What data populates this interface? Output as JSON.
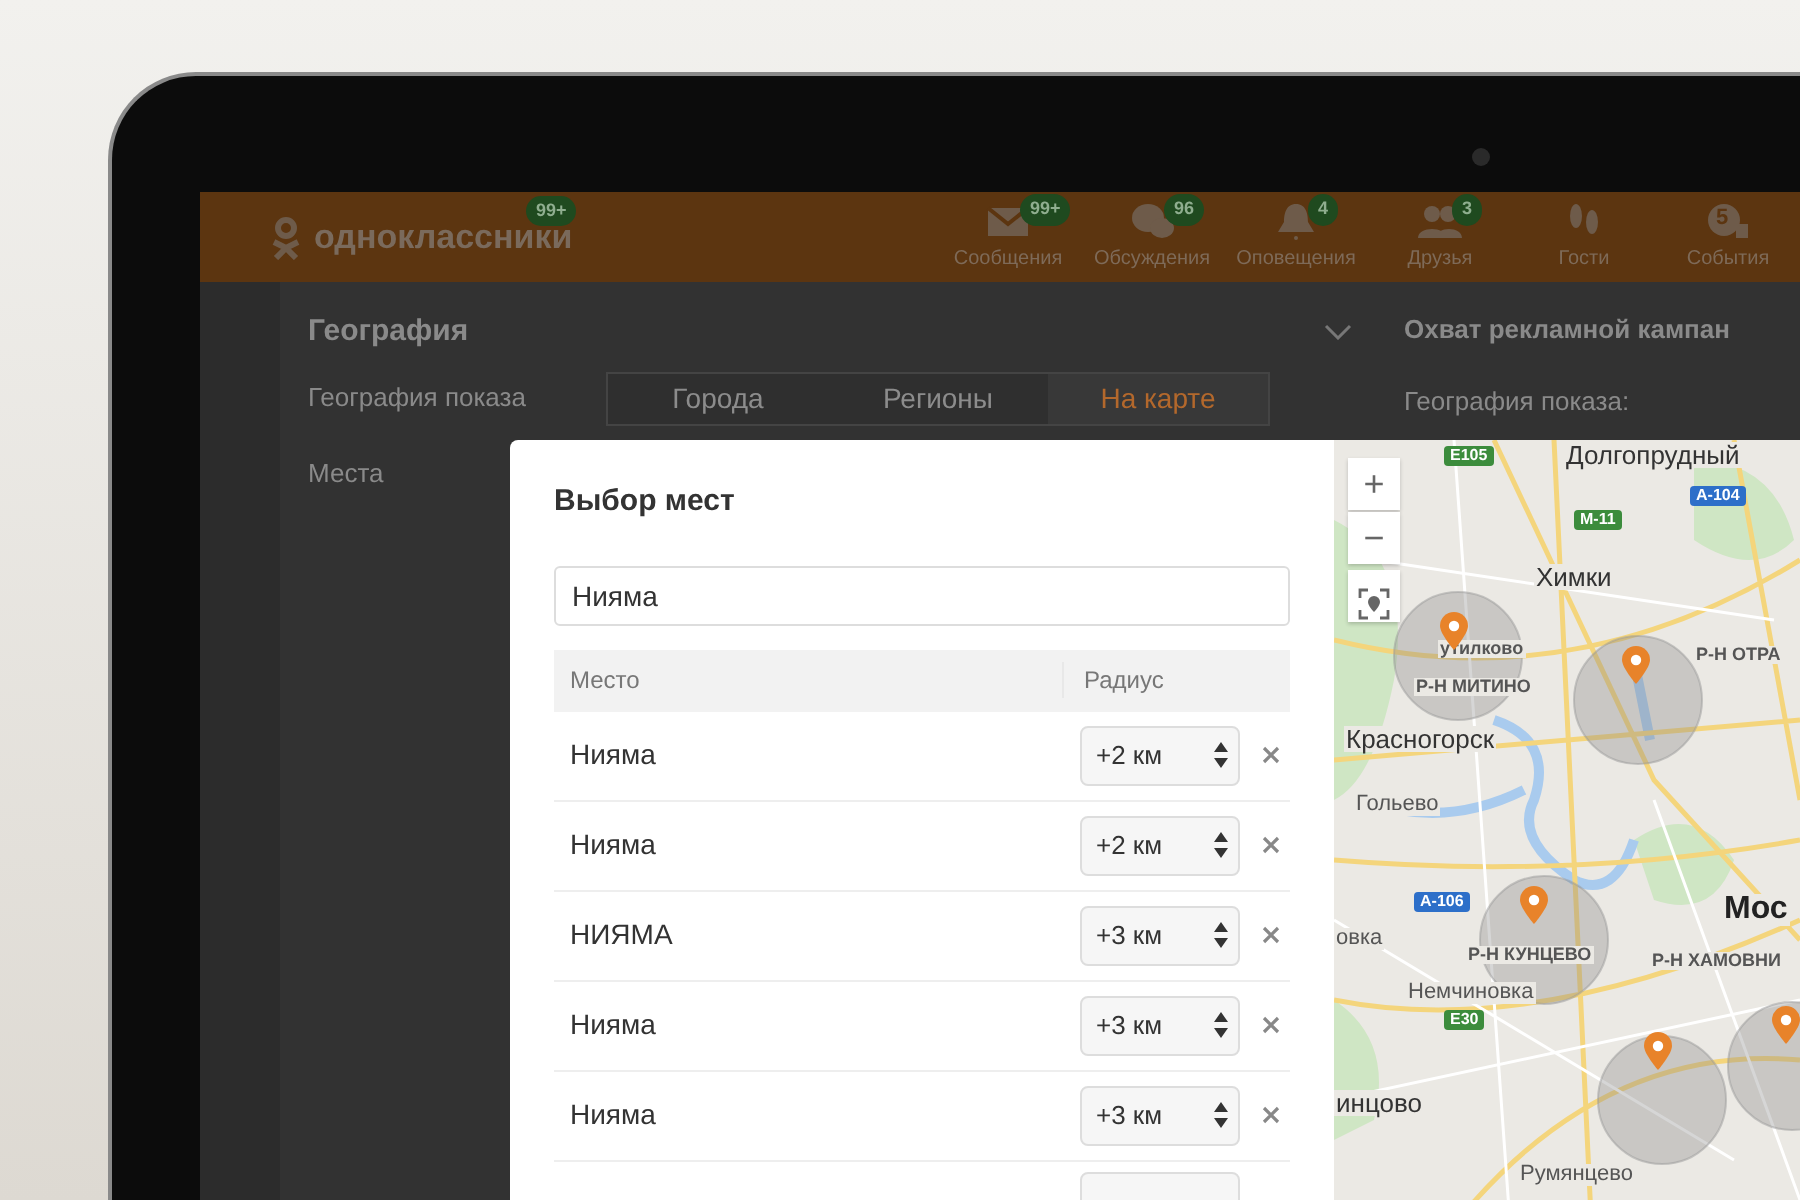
{
  "header": {
    "logo": "одноклассники",
    "logo_badge": "99+",
    "nav": [
      {
        "kind": "mail",
        "label": "Сообщения",
        "badge": "99+"
      },
      {
        "kind": "chat",
        "label": "Обсуждения",
        "badge": "96"
      },
      {
        "kind": "bell",
        "label": "Оповещения",
        "badge": "4"
      },
      {
        "kind": "friends",
        "label": "Друзья",
        "badge": "3"
      },
      {
        "kind": "guests",
        "label": "Гости"
      },
      {
        "kind": "events",
        "label": "События",
        "icon_text": "5"
      }
    ]
  },
  "geo_panel": {
    "title": "География",
    "expanded": true,
    "rows": [
      {
        "label": "География показа"
      },
      {
        "label": "Места"
      }
    ],
    "tabs": [
      {
        "label": "Города",
        "selected": false
      },
      {
        "label": "Регионы",
        "selected": false
      },
      {
        "label": "На карте",
        "selected": true
      }
    ]
  },
  "reach_panel": {
    "title": "Охват рекламной кампан",
    "subtitle": "География показа:"
  },
  "modal": {
    "title": "Выбор мест",
    "search": {
      "value": "Нияма"
    },
    "columns": [
      "Место",
      "Радиус"
    ],
    "rows": [
      {
        "place": "Нияма",
        "radius": "+2 км"
      },
      {
        "place": "Нияма",
        "radius": "+2 км"
      },
      {
        "place": "НИЯМА",
        "radius": "+3 км"
      },
      {
        "place": "Нияма",
        "radius": "+3 км"
      },
      {
        "place": "Нияма",
        "radius": "+3 км"
      }
    ]
  },
  "map": {
    "zoom_in": "+",
    "zoom_out": "−",
    "labels": [
      {
        "kind": "road",
        "text": "E105",
        "color": "#3c8c3c"
      },
      {
        "kind": "city",
        "text": "Долгопрудный"
      },
      {
        "kind": "road",
        "text": "A-104",
        "color": "#2d6fc9"
      },
      {
        "kind": "road",
        "text": "M-11",
        "color": "#3c8c3c"
      },
      {
        "kind": "city",
        "text": "Химки"
      },
      {
        "kind": "district",
        "text": "утилково"
      },
      {
        "kind": "district",
        "text": "Р-Н МИТИНО"
      },
      {
        "kind": "district",
        "text": "Р-Н ОТРА"
      },
      {
        "kind": "city",
        "text": "Красногорск"
      },
      {
        "kind": "town",
        "text": "Гольево"
      },
      {
        "kind": "road",
        "text": "A-106",
        "color": "#2d6fc9"
      },
      {
        "kind": "town",
        "text": "овка"
      },
      {
        "kind": "district",
        "text": "Р-Н КУНЦЕВО"
      },
      {
        "kind": "capital",
        "text": "Мос"
      },
      {
        "kind": "district",
        "text": "Р-Н ХАМОВНИ"
      },
      {
        "kind": "town",
        "text": "Немчиновка"
      },
      {
        "kind": "road",
        "text": "E30",
        "color": "#3c8c3c"
      },
      {
        "kind": "city",
        "text": "инцово"
      },
      {
        "kind": "town",
        "text": "Румянцево"
      }
    ]
  }
}
